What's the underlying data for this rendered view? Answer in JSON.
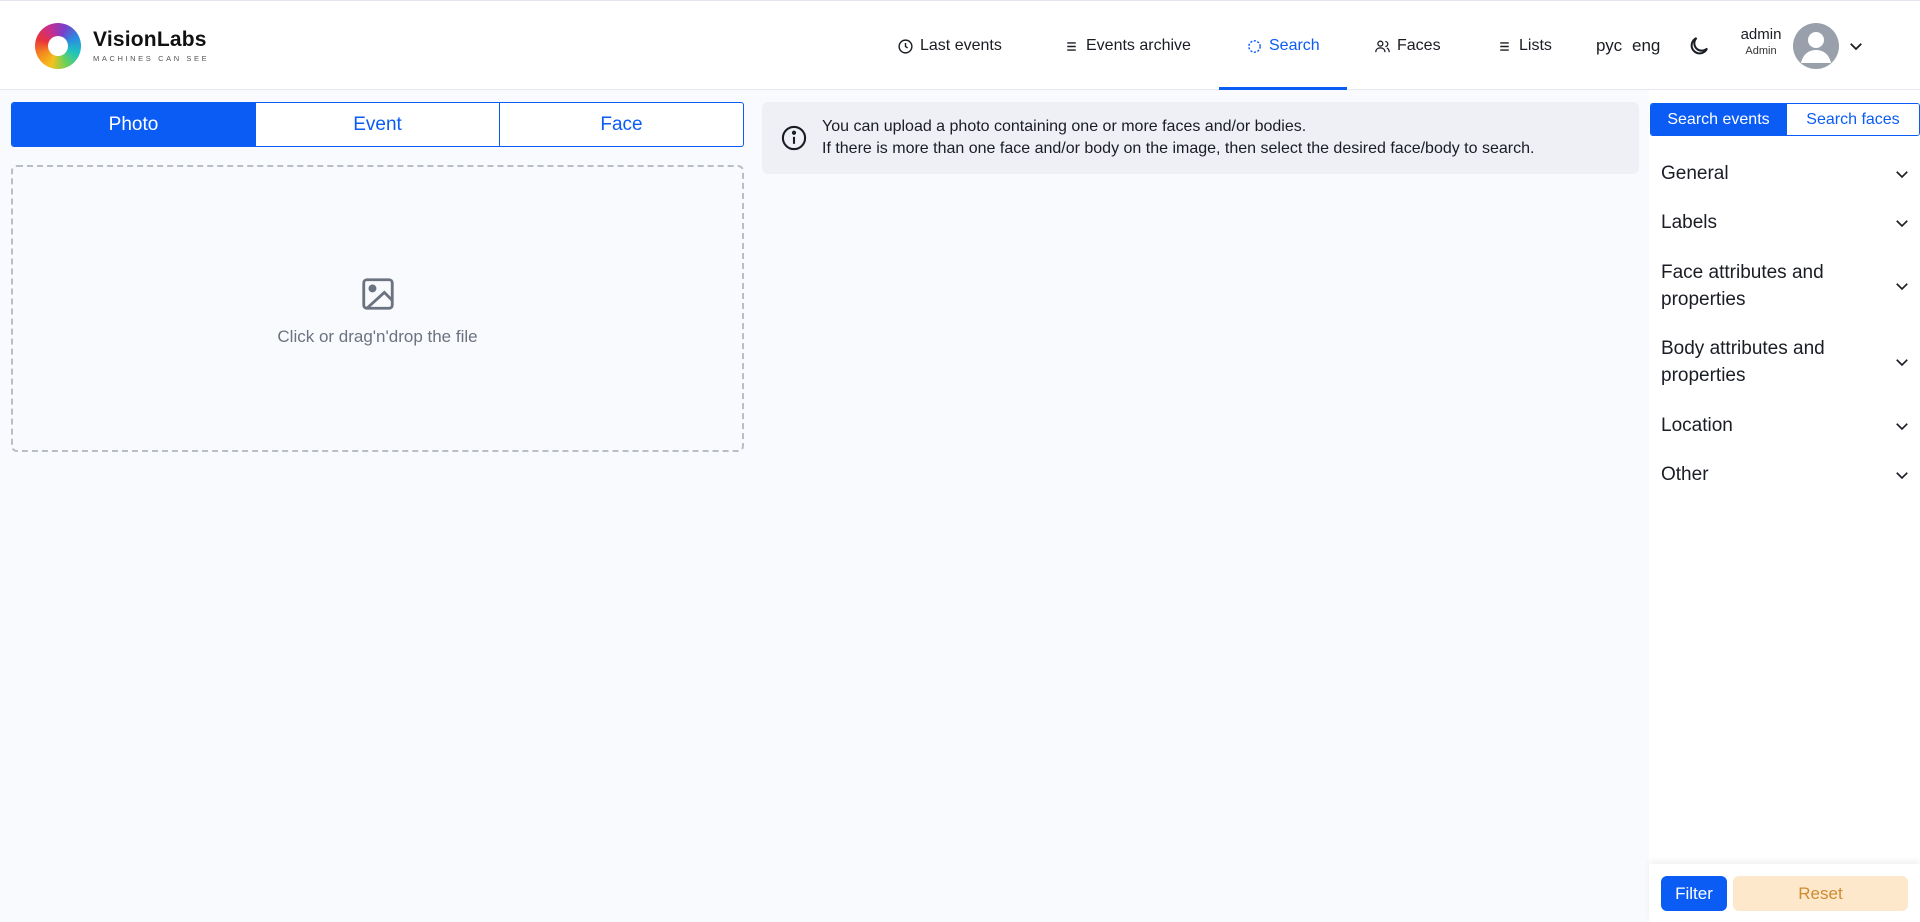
{
  "brand": {
    "name": "VisionLabs",
    "tagline": "MACHINES CAN SEE"
  },
  "nav": {
    "last_events": "Last events",
    "events_archive": "Events archive",
    "search": "Search",
    "faces": "Faces",
    "lists": "Lists",
    "active": "Search"
  },
  "lang": {
    "ru": "рус",
    "en": "eng"
  },
  "user": {
    "name": "admin",
    "role": "Admin"
  },
  "search_tabs": {
    "photo": "Photo",
    "event": "Event",
    "face": "Face",
    "active": "Photo"
  },
  "dropzone": {
    "text": "Click or drag'n'drop the file"
  },
  "info": {
    "line1": "You can upload a photo containing one or more faces and/or bodies.",
    "line2": "If there is more than one face and/or body on the image, then select the desired face/body to search."
  },
  "filters": {
    "toggle": {
      "events": "Search events",
      "faces": "Search faces",
      "active": "Search events"
    },
    "sections": [
      "General",
      "Labels",
      "Face attributes and properties",
      "Body attributes and properties",
      "Location",
      "Other"
    ],
    "filter_button": "Filter",
    "reset_button": "Reset"
  },
  "colors": {
    "accent": "#0a5cf5",
    "reset_bg": "#fde8cc",
    "reset_text": "#d08a30",
    "background": "#f9fafd"
  }
}
